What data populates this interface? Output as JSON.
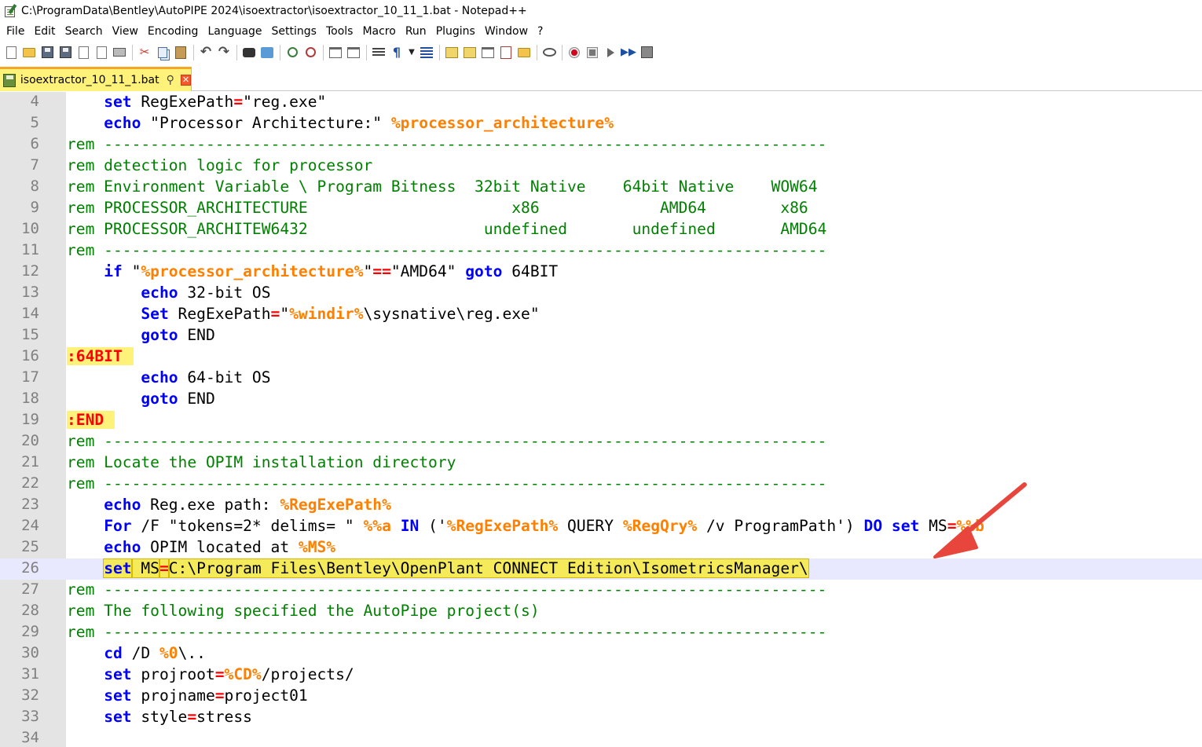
{
  "window": {
    "title": "C:\\ProgramData\\Bentley\\AutoPIPE 2024\\isoextractor\\isoextractor_10_11_1.bat - Notepad++"
  },
  "menu": [
    "File",
    "Edit",
    "Search",
    "View",
    "Encoding",
    "Language",
    "Settings",
    "Tools",
    "Macro",
    "Run",
    "Plugins",
    "Window",
    "?"
  ],
  "toolbar": {
    "icons": [
      "new-file-icon",
      "open-file-icon",
      "save-icon",
      "save-all-icon",
      "close-icon",
      "close-all-icon",
      "print-icon",
      "cut-icon",
      "copy-icon",
      "paste-icon",
      "undo-icon",
      "redo-icon",
      "find-icon",
      "replace-icon",
      "zoom-in-icon",
      "zoom-out-icon",
      "sync-vertical-icon",
      "sync-horizontal-icon",
      "word-wrap-icon",
      "show-all-characters-icon",
      "indent-guide-icon",
      "document-map-icon",
      "function-list-icon",
      "folder-as-workspace-icon",
      "monitoring-icon",
      "record-macro-icon",
      "stop-recording-icon",
      "playback-icon",
      "run-macro-multiple-icon",
      "save-macro-icon"
    ]
  },
  "tab": {
    "label": "isoextractor_10_11_1.bat",
    "pin_glyph": "⚲",
    "close_glyph": "✕"
  },
  "editor": {
    "current_line": 26,
    "lines": [
      {
        "n": "4",
        "tokens": [
          [
            "    ",
            ""
          ],
          [
            "set",
            "kw"
          ],
          [
            " RegExePath",
            ""
          ],
          [
            "=",
            "op"
          ],
          [
            "\"reg.exe\"",
            ""
          ]
        ]
      },
      {
        "n": "5",
        "tokens": [
          [
            "    ",
            ""
          ],
          [
            "echo",
            "kw"
          ],
          [
            " \"Processor Architecture:\" ",
            ""
          ],
          [
            "%processor_architecture%",
            "var"
          ]
        ]
      },
      {
        "n": "6",
        "tokens": [
          [
            "rem ------------------------------------------------------------------------------",
            "cmt"
          ]
        ]
      },
      {
        "n": "7",
        "tokens": [
          [
            "rem detection logic for processor",
            "cmt"
          ]
        ]
      },
      {
        "n": "8",
        "tokens": [
          [
            "rem Environment Variable \\ Program Bitness  32bit Native    64bit Native    WOW64",
            "cmt"
          ]
        ]
      },
      {
        "n": "9",
        "tokens": [
          [
            "rem PROCESSOR_ARCHITECTURE                      x86             AMD64        x86",
            "cmt"
          ]
        ]
      },
      {
        "n": "10",
        "tokens": [
          [
            "rem PROCESSOR_ARCHITEW6432                   undefined       undefined       AMD64",
            "cmt"
          ]
        ]
      },
      {
        "n": "11",
        "tokens": [
          [
            "rem ------------------------------------------------------------------------------",
            "cmt"
          ]
        ]
      },
      {
        "n": "12",
        "tokens": [
          [
            "    ",
            ""
          ],
          [
            "if",
            "kw"
          ],
          [
            " \"",
            ""
          ],
          [
            "%processor_architecture%",
            "var"
          ],
          [
            "\"",
            ""
          ],
          [
            "==",
            "op"
          ],
          [
            "\"AMD64\" ",
            ""
          ],
          [
            "goto",
            "kw"
          ],
          [
            " 64BIT",
            ""
          ]
        ]
      },
      {
        "n": "13",
        "tokens": [
          [
            "        ",
            ""
          ],
          [
            "echo",
            "kw"
          ],
          [
            " 32-bit OS",
            ""
          ]
        ]
      },
      {
        "n": "14",
        "tokens": [
          [
            "        ",
            ""
          ],
          [
            "Set",
            "kw"
          ],
          [
            " RegExePath",
            ""
          ],
          [
            "=",
            "op"
          ],
          [
            "\"",
            ""
          ],
          [
            "%windir%",
            "var"
          ],
          [
            "\\sysnative\\reg.exe\"",
            ""
          ]
        ]
      },
      {
        "n": "15",
        "tokens": [
          [
            "        ",
            ""
          ],
          [
            "goto",
            "kw"
          ],
          [
            " END",
            ""
          ]
        ]
      },
      {
        "n": "16",
        "tokens": [
          [
            ":64BIT",
            "lbl"
          ]
        ]
      },
      {
        "n": "17",
        "tokens": [
          [
            "        ",
            ""
          ],
          [
            "echo",
            "kw"
          ],
          [
            " 64-bit OS",
            ""
          ]
        ]
      },
      {
        "n": "18",
        "tokens": [
          [
            "        ",
            ""
          ],
          [
            "goto",
            "kw"
          ],
          [
            " END",
            ""
          ]
        ]
      },
      {
        "n": "19",
        "tokens": [
          [
            ":END",
            "lbl"
          ]
        ]
      },
      {
        "n": "20",
        "tokens": [
          [
            "rem ------------------------------------------------------------------------------",
            "cmt"
          ]
        ]
      },
      {
        "n": "21",
        "tokens": [
          [
            "rem Locate the OPIM installation directory",
            "cmt"
          ]
        ]
      },
      {
        "n": "22",
        "tokens": [
          [
            "rem ------------------------------------------------------------------------------",
            "cmt"
          ]
        ]
      },
      {
        "n": "23",
        "tokens": [
          [
            "    ",
            ""
          ],
          [
            "echo",
            "kw"
          ],
          [
            " Reg.exe path: ",
            ""
          ],
          [
            "%RegExePath%",
            "var"
          ]
        ]
      },
      {
        "n": "24",
        "tokens": [
          [
            "    ",
            ""
          ],
          [
            "For",
            "kw"
          ],
          [
            " /F \"tokens=2* delims= \" ",
            ""
          ],
          [
            "%%a",
            "var"
          ],
          [
            " ",
            ""
          ],
          [
            "IN",
            "kw"
          ],
          [
            " ('",
            ""
          ],
          [
            "%RegExePath%",
            "var"
          ],
          [
            " QUERY ",
            ""
          ],
          [
            "%RegQry%",
            "var"
          ],
          [
            " /v ProgramPath') ",
            ""
          ],
          [
            "DO",
            "kw"
          ],
          [
            " ",
            ""
          ],
          [
            "set",
            "kw"
          ],
          [
            " MS",
            ""
          ],
          [
            "=",
            "op"
          ],
          [
            "%%b",
            "var"
          ]
        ]
      },
      {
        "n": "25",
        "tokens": [
          [
            "    ",
            ""
          ],
          [
            "echo",
            "kw"
          ],
          [
            " OPIM located at ",
            ""
          ],
          [
            "%MS%",
            "var"
          ]
        ]
      },
      {
        "n": "26",
        "tokens": [
          [
            "    ",
            ""
          ],
          [
            "set",
            "kw hl"
          ],
          [
            " MS",
            "hl"
          ],
          [
            "=",
            "op hl"
          ],
          [
            "C:\\Program Files\\Bentley\\OpenPlant CONNECT Edition\\IsometricsManager\\",
            "hl"
          ]
        ]
      },
      {
        "n": "27",
        "tokens": [
          [
            "rem ------------------------------------------------------------------------------",
            "cmt"
          ]
        ]
      },
      {
        "n": "28",
        "tokens": [
          [
            "rem The following specified the AutoPipe project(s)",
            "cmt"
          ]
        ]
      },
      {
        "n": "29",
        "tokens": [
          [
            "rem ------------------------------------------------------------------------------",
            "cmt"
          ]
        ]
      },
      {
        "n": "30",
        "tokens": [
          [
            "    ",
            ""
          ],
          [
            "cd",
            "kw"
          ],
          [
            " /D ",
            ""
          ],
          [
            "%0",
            "var"
          ],
          [
            "\\..",
            ""
          ]
        ]
      },
      {
        "n": "31",
        "tokens": [
          [
            "    ",
            ""
          ],
          [
            "set",
            "kw"
          ],
          [
            " projroot",
            ""
          ],
          [
            "=",
            "op"
          ],
          [
            "%CD%",
            "var"
          ],
          [
            "/projects/",
            ""
          ]
        ]
      },
      {
        "n": "32",
        "tokens": [
          [
            "    ",
            ""
          ],
          [
            "set",
            "kw"
          ],
          [
            " projname",
            ""
          ],
          [
            "=",
            "op"
          ],
          [
            "project01",
            ""
          ]
        ]
      },
      {
        "n": "33",
        "tokens": [
          [
            "    ",
            ""
          ],
          [
            "set",
            "kw"
          ],
          [
            " style",
            ""
          ],
          [
            "=",
            "op"
          ],
          [
            "stress",
            ""
          ]
        ]
      },
      {
        "n": "34",
        "tokens": []
      }
    ]
  },
  "colors": {
    "keyword": "#0000ff",
    "comment": "#008000",
    "variable": "#ff8000",
    "operator": "#ff0000",
    "label_bg": "#fff27a",
    "highlight_bg": "#f4ea5a",
    "arrow": "#e8453c"
  }
}
